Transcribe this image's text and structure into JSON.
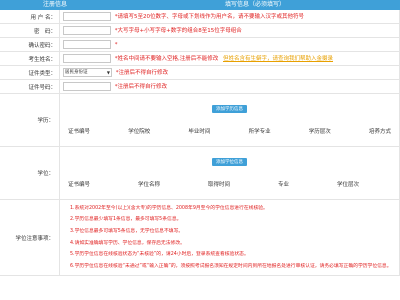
{
  "header": {
    "left": "注册信息",
    "right": "填写信息（必须填写）"
  },
  "fields": {
    "username": {
      "label": "用 户 名：",
      "hint": "*请填写5至20位数字、字母或下划线作为用户名，请不要输入汉字或其他符号"
    },
    "password": {
      "label": "密　码：",
      "hint": "*大写字母+小写字母+数字的组合8至15位字母组合"
    },
    "confirm": {
      "label": "确认密码：",
      "hint": "*"
    },
    "name": {
      "label": "考生姓名：",
      "hint": "*姓名中间请不要输入空格,注册后不能修改",
      "link": "但姓名含有生僻字，请查询我们帮助入金摄录"
    },
    "idtype": {
      "label": "证件类型：",
      "selected": "居民身份证",
      "hint": "*注册后不得自行修改"
    },
    "idnum": {
      "label": "证件号码：",
      "hint": "*注册后不得自行修改"
    }
  },
  "education": {
    "label": "学历：",
    "button": "添加学历信息",
    "columns": [
      "证书编号",
      "学位院校",
      "毕业时间",
      "所学专业",
      "学历层次",
      "培养方式"
    ]
  },
  "degree": {
    "label": "学位：",
    "button": "添加学位信息",
    "columns": [
      "证书编号",
      "学位名称",
      "取得时间",
      "专业",
      "学位层次"
    ]
  },
  "notes": {
    "label": "学位注意事项：",
    "items": [
      "1.系统对2002年至今(以上)(含大专)的学历信息、2008年9月至今的学位信息进行在线核验。",
      "2.学历信息最少填写1条信息，最多可填写5条信息。",
      "3.学位信息最多可填写5条信息，无学位信息不填写。",
      "4.请如实准确填写学历、学位信息，保存后无法修改。",
      "5.学历学位信息在线核验状态为“未核验”的，请24小时后，登录系统查看核验状态。",
      "6.学历学位信息在线核验“未通过”或“输入正确”的，须按照考试报名须知在规定时间内到所在地报名处进行审核认证，请务必填写正确的学历学位信息。"
    ]
  }
}
